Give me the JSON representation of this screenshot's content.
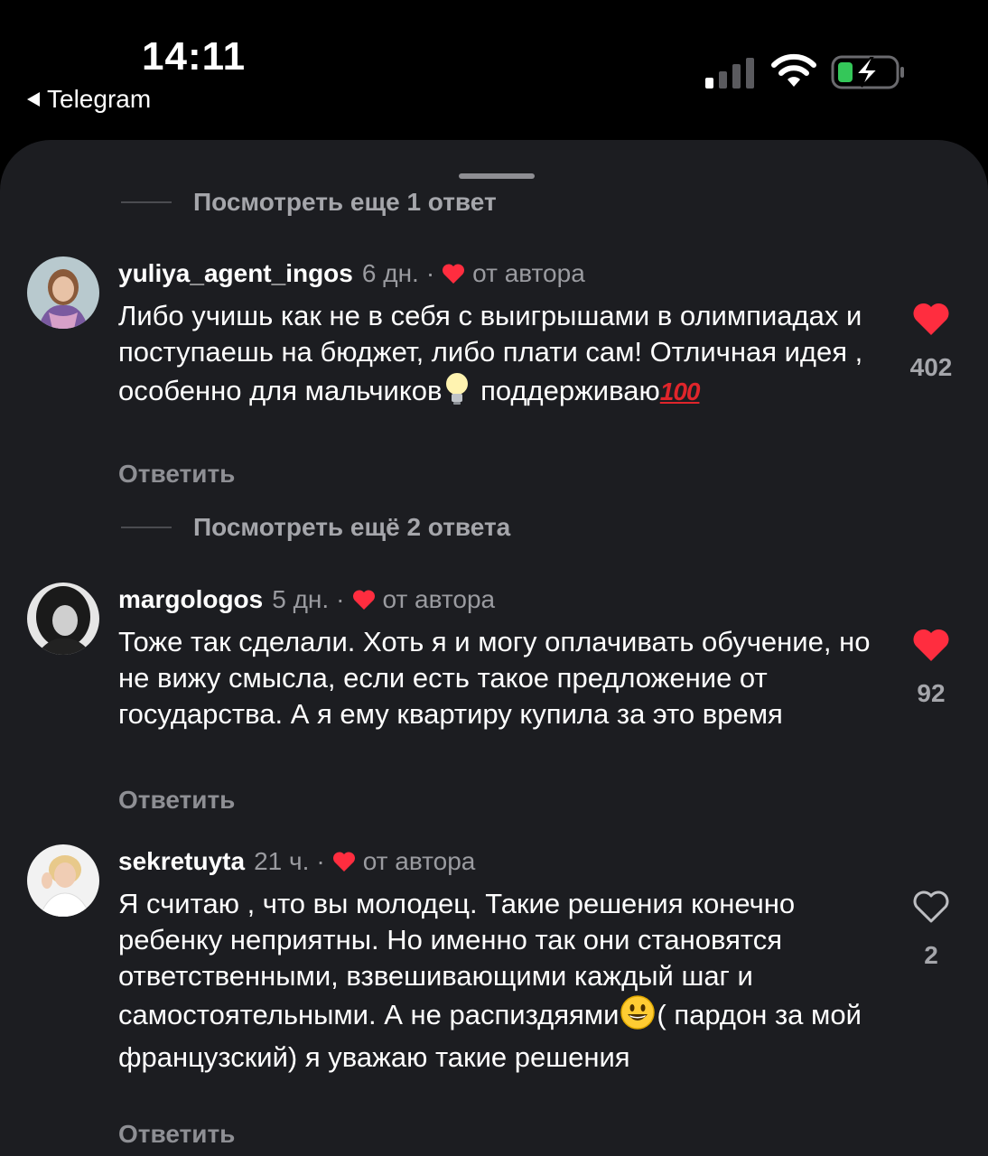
{
  "status_bar": {
    "time": "14:11",
    "back_label": "Telegram"
  },
  "sheet": {
    "top_more_replies": "Посмотреть еще 1 ответ",
    "middle_more_replies": "Посмотреть ещё 2 ответа"
  },
  "comments": [
    {
      "username": "yuliya_agent_ingos",
      "time": "6 дн.",
      "separator": "·",
      "author_label": "от автора",
      "text_main": "Либо учишь как не в себя с выигрышами в олимпиадах и поступаешь на бюджет, либо плати сам! Отличная идея , особенно для мальчиков",
      "text_tail": " поддерживаю",
      "emoji_1": "lightbulb-emoji",
      "emoji_2": "hundred-points-emoji",
      "hundred_glyph": "100",
      "reply_label": "Ответить",
      "likes": "402",
      "liked": true
    },
    {
      "username": "margologos",
      "time": "5 дн.",
      "separator": "·",
      "author_label": "от автора",
      "text": "Тоже так сделали. Хоть я и могу оплачивать обучение, но не вижу смысла, если есть такое предложение от государства. А я ему квартиру купила за это время",
      "reply_label": "Ответить",
      "likes": "92",
      "liked": true
    },
    {
      "username": "sekretuyta",
      "time": "21 ч.",
      "separator": "·",
      "author_label": "от автора",
      "text_main": "Я считаю , что вы молодец. Такие решения конечно ребенку неприятны. Но именно так они становятся ответственными, взвешивающими каждый шаг и самостоятельными. А не распиздяями",
      "text_tail": "( пардон за мой французский)  я уважаю такие решения",
      "emoji_1": "smiling-face-emoji",
      "reply_label": "Ответить",
      "likes": "2",
      "liked": false
    }
  ],
  "colors": {
    "sheet_background": "#1c1d21",
    "like_red": "#ff2d3f",
    "secondary_text": "#9a9ba0"
  }
}
